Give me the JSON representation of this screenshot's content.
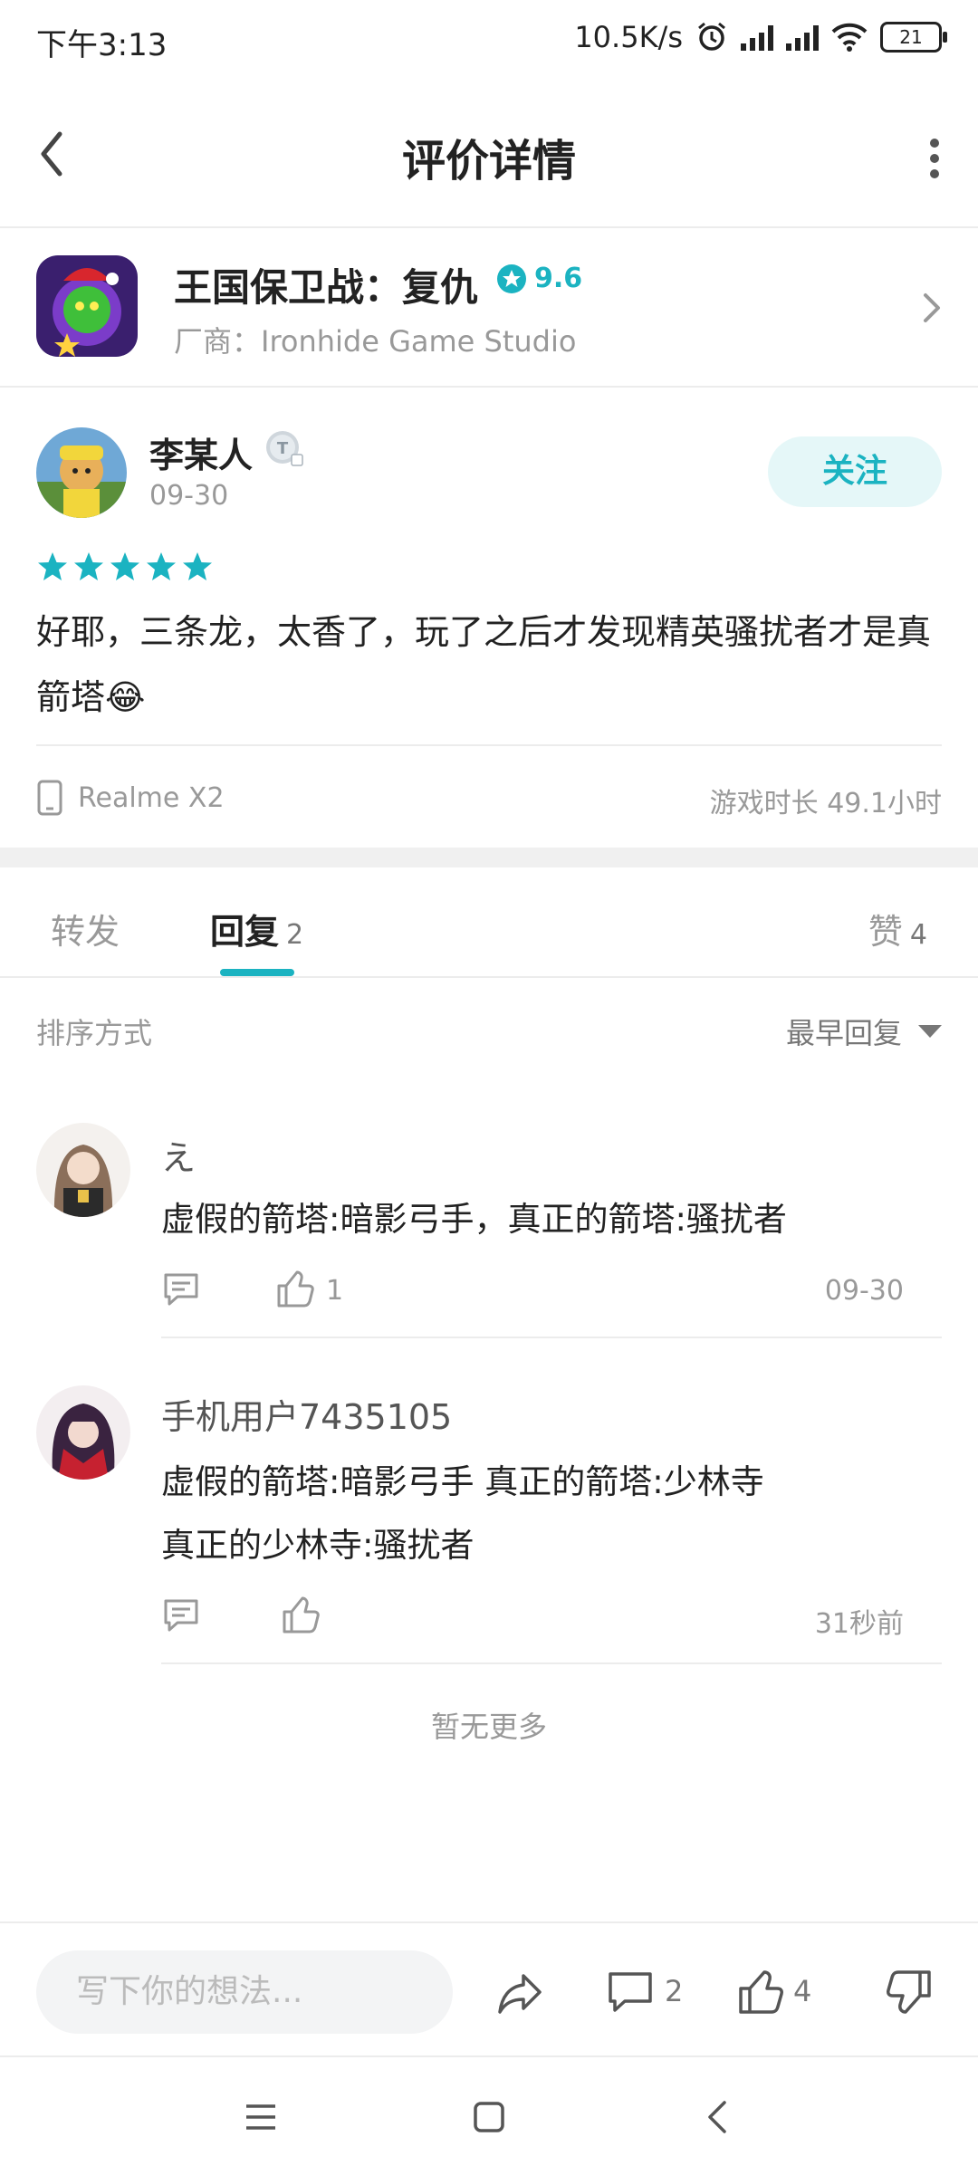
{
  "status_bar": {
    "time": "下午3:13",
    "net_speed": "10.5K/s",
    "battery": "21"
  },
  "header": {
    "title": "评价详情"
  },
  "game": {
    "name": "王国保卫战：复仇",
    "rating": "9.6",
    "developer": "厂商：Ironhide Game Studio"
  },
  "review": {
    "user_name": "李某人",
    "date": "09-30",
    "follow_label": "关注",
    "stars": 5,
    "text": "好耶，三条龙，太香了，玩了之后才发现精英骚扰者才是真箭塔😂",
    "device": "Realme X2",
    "playtime": "游戏时长 49.1小时"
  },
  "tabs": [
    {
      "label": "转发",
      "count": ""
    },
    {
      "label": "回复",
      "count": "2"
    },
    {
      "label": "赞",
      "count": "4"
    }
  ],
  "sort": {
    "label": "排序方式",
    "value": "最早回复"
  },
  "comments": [
    {
      "name": "え",
      "text": "虚假的箭塔:暗影弓手，真正的箭塔:骚扰者",
      "likes": "1",
      "time": "09-30"
    },
    {
      "name": "手机用户7435105",
      "text": "虚假的箭塔:暗影弓手 真正的箭塔:少林寺\n真正的少林寺:骚扰者",
      "likes": "",
      "time": "31秒前"
    }
  ],
  "no_more": "暂无更多",
  "bottom_bar": {
    "input_placeholder": "写下你的想法...",
    "comment_count": "2",
    "like_count": "4"
  },
  "colors": {
    "accent": "#1bb3c1",
    "text_primary": "#222222",
    "text_secondary": "#999999",
    "divider": "#ececec"
  }
}
